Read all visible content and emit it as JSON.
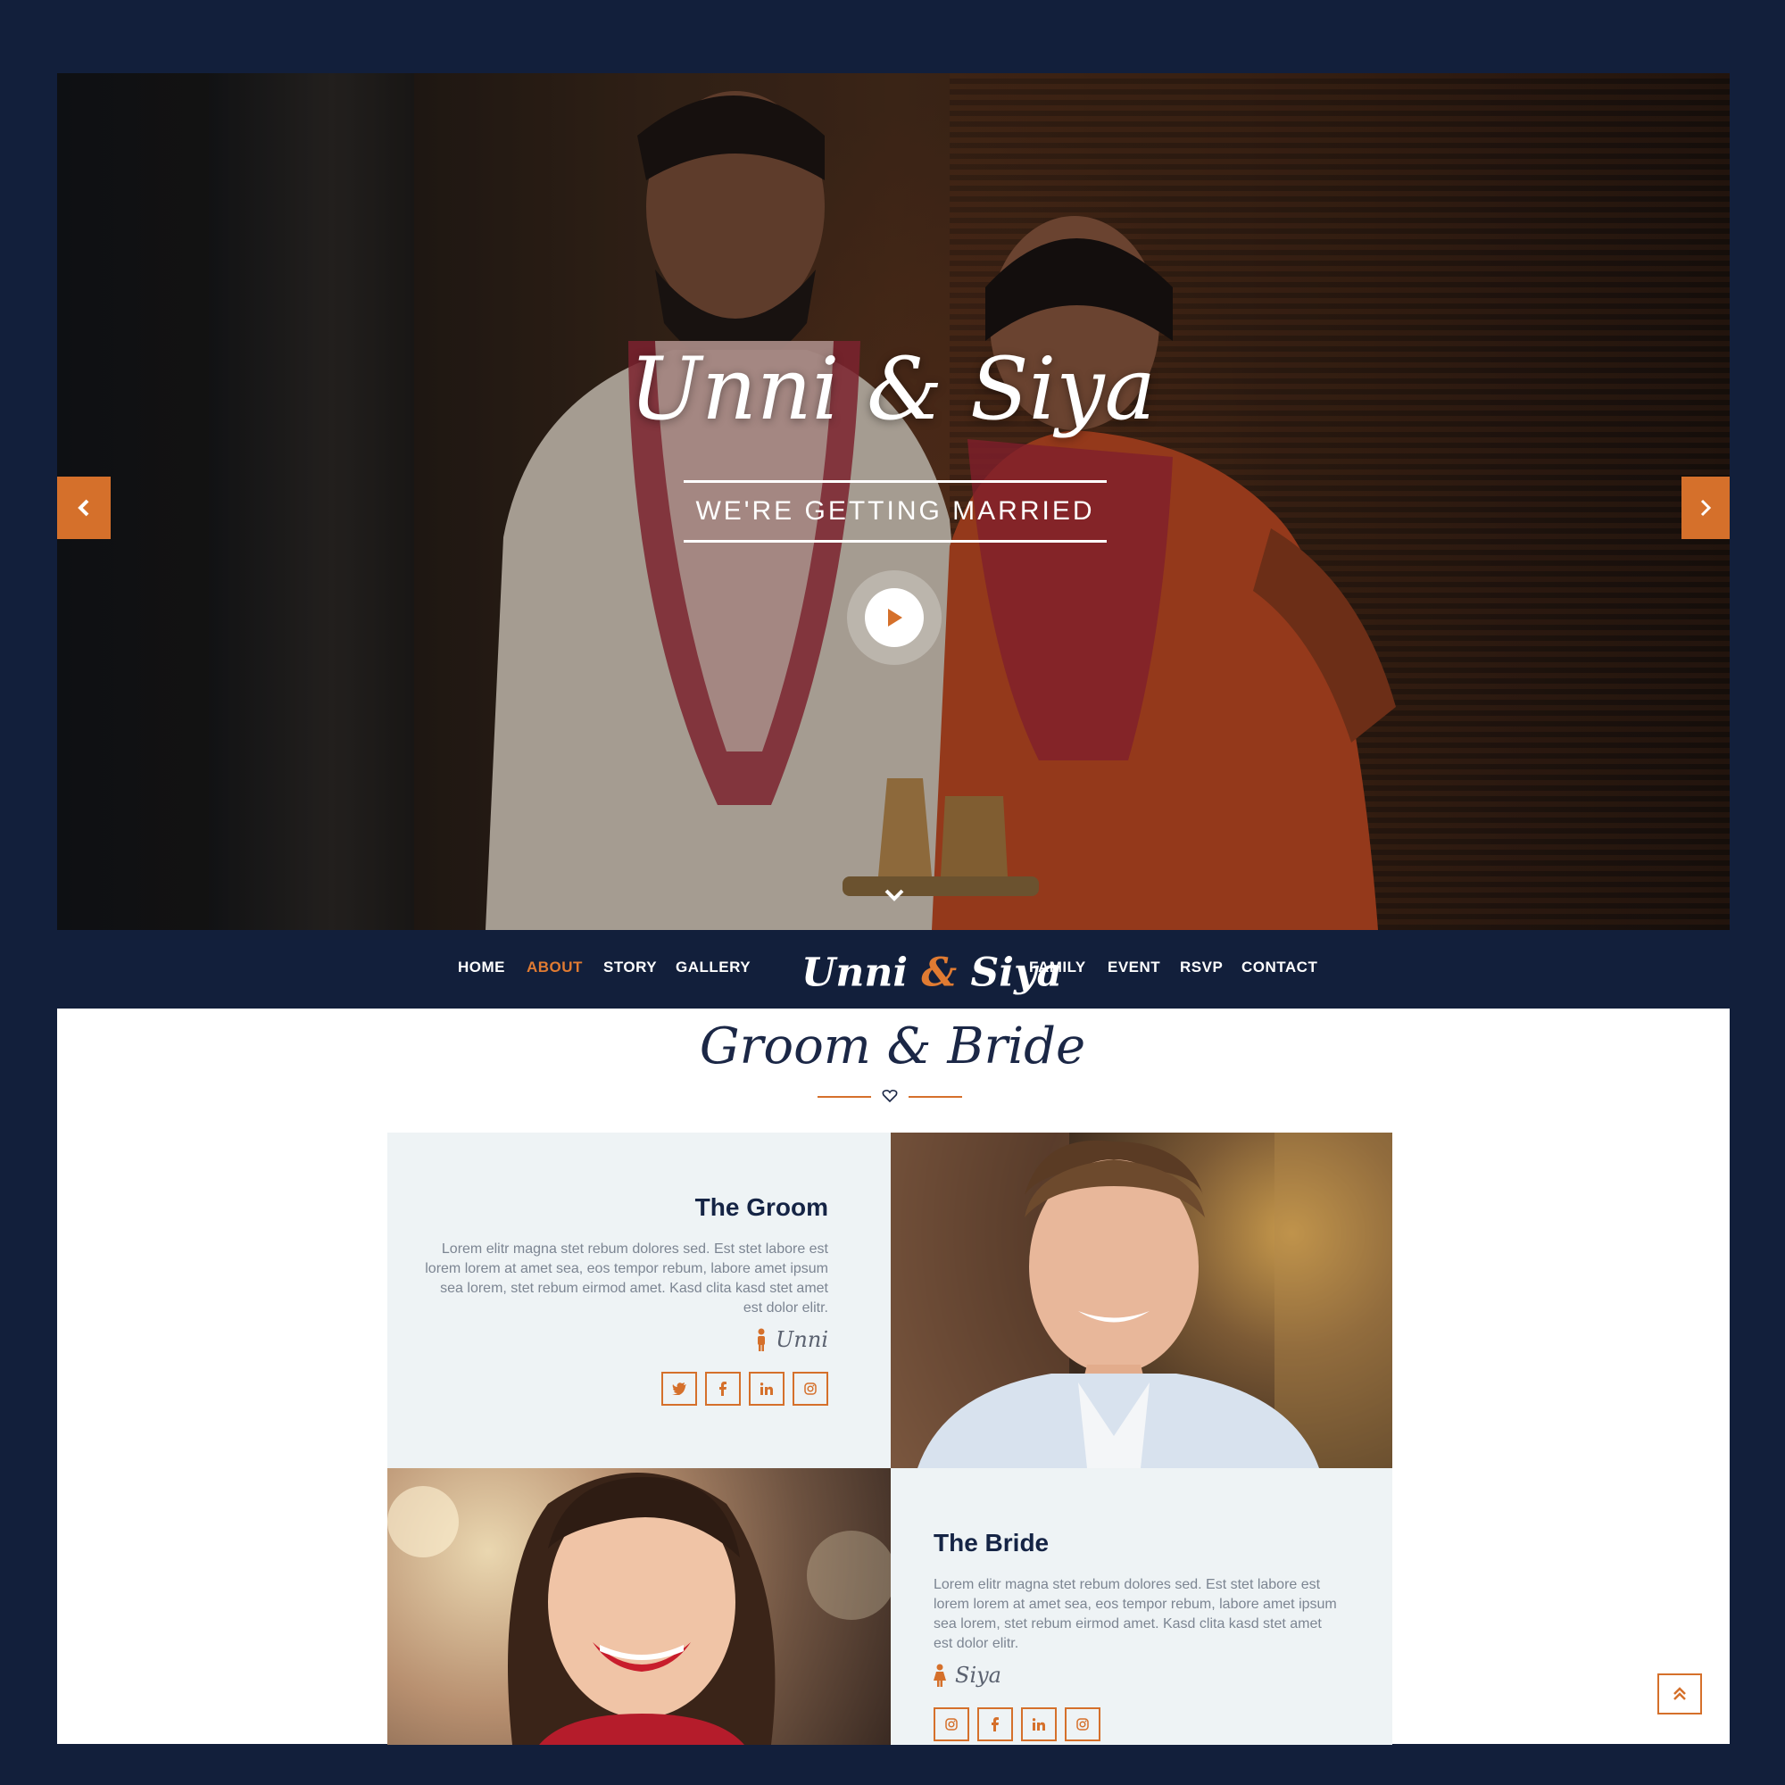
{
  "hero": {
    "title": "Unni & Siya",
    "subtitle": "WE'RE GETTING MARRIED"
  },
  "nav": {
    "left_items": [
      "HOME",
      "ABOUT",
      "STORY",
      "GALLERY"
    ],
    "logo_first": "Unni",
    "logo_amp": "&",
    "logo_second": "Siya",
    "right_items": [
      "FAMILY",
      "EVENT",
      "RSVP",
      "CONTACT"
    ],
    "active": "ABOUT"
  },
  "section": {
    "title": "Groom & Bride"
  },
  "groom": {
    "title": "The Groom",
    "text": "Lorem elitr magna stet rebum dolores sed. Est stet labore est lorem lorem at amet sea, eos tempor rebum, labore amet ipsum sea lorem, stet rebum eirmod amet. Kasd clita kasd stet amet est dolor elitr.",
    "signature": "Unni",
    "socials": [
      "twitter-icon",
      "facebook-icon",
      "linkedin-icon",
      "instagram-icon"
    ]
  },
  "bride": {
    "title": "The Bride",
    "text": "Lorem elitr magna stet rebum dolores sed. Est stet labore est lorem lorem at amet sea, eos tempor rebum, labore amet ipsum sea lorem, stet rebum eirmod amet. Kasd clita kasd stet amet est dolor elitr.",
    "signature": "Siya",
    "socials": [
      "instagram-icon",
      "facebook-icon",
      "linkedin-icon",
      "instagram-icon"
    ]
  },
  "colors": {
    "accent": "#d5702b",
    "navy": "#121f3b",
    "panel": "#eef3f5"
  }
}
